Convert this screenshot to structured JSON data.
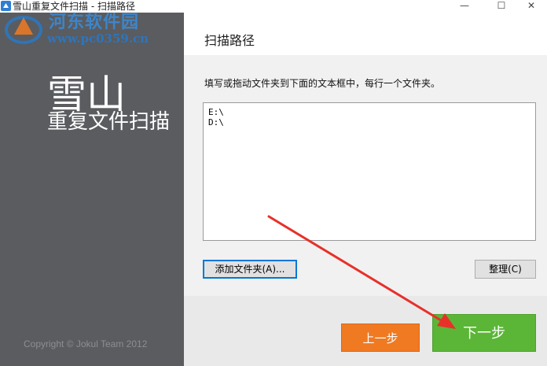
{
  "window": {
    "title": "雪山重复文件扫描 - 扫描路径",
    "minimize": "—",
    "maximize": "☐",
    "close": "✕"
  },
  "watermark": {
    "site_name": "河东软件园",
    "url": "www.pc0359.cn"
  },
  "sidebar": {
    "brand_main": "雪山",
    "brand_sub": "重复文件扫描",
    "copyright": "Copyright © Jokul Team 2012"
  },
  "header": {
    "title": "扫描路径"
  },
  "content": {
    "instruction": "填写或拖动文件夹到下面的文本框中，每行一个文件夹。",
    "paths": [
      "E:\\",
      "D:\\"
    ],
    "add_folder_label": "添加文件夹(A)...",
    "tidy_label": "整理(C)"
  },
  "footer": {
    "prev_label": "上一步",
    "next_label": "下一步"
  },
  "colors": {
    "sidebar_bg": "#5a5c60",
    "prev_button": "#f07a22",
    "next_button": "#5bb637",
    "annotation_arrow": "#e8302a"
  }
}
